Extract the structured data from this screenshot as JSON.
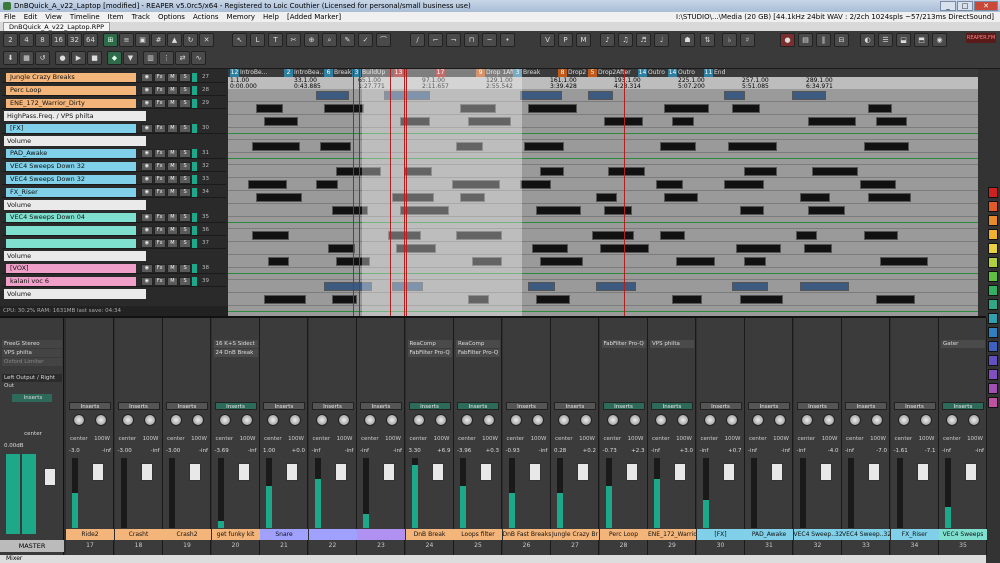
{
  "window": {
    "title": "DnBQuick_A_v22_Laptop [modified] - REAPER v5.0rc5/x64 - Registered to Loic Couthier (Licensed for personal/small business use)",
    "buttons": [
      "_",
      "□",
      "✕"
    ]
  },
  "menu": {
    "items": [
      "File",
      "Edit",
      "View",
      "Timeline",
      "Item",
      "Track",
      "Options",
      "Actions",
      "Memory",
      "Help",
      "[Added Marker]"
    ],
    "status": "I:\\STUDIO\\...\\Media (20 GB) [44.1kHz 24bit WAV : 2/2ch 1024spls ~57/213ms DirectSound]"
  },
  "project_tab": "DnBQuick_A_v22_Laptop.RPP",
  "toolbar": {
    "grid_values": [
      "2",
      "4",
      "8",
      "16",
      "32",
      "64"
    ],
    "brand": "REAPER.FM"
  },
  "regions": [
    {
      "num": "12",
      "name": "IntroBe...",
      "color": "#2e7fa0"
    },
    {
      "num": "2",
      "name": "IntroBea...",
      "color": "#2e7fa0"
    },
    {
      "num": "6",
      "name": "Break2",
      "color": "#2e7fa0"
    },
    {
      "num": "3",
      "name": "BuildUp",
      "color": "#2e7fa0"
    },
    {
      "num": "13",
      "name": "",
      "color": "#a02020"
    },
    {
      "num": "17",
      "name": "",
      "color": "#a02020"
    },
    {
      "num": "9",
      "name": "Drop 1Afte",
      "color": "#c05a1a"
    },
    {
      "num": "3",
      "name": "Break",
      "color": "#2e7fa0"
    },
    {
      "num": "8",
      "name": "Drop2",
      "color": "#c05a1a"
    },
    {
      "num": "5",
      "name": "Drop2After",
      "color": "#c05a1a"
    },
    {
      "num": "14",
      "name": "Outro",
      "color": "#2e7fa0"
    },
    {
      "num": "14",
      "name": "Outro",
      "color": "#2e7fa0"
    },
    {
      "num": "11",
      "name": "End",
      "color": "#2e7fa0"
    }
  ],
  "ruler": [
    {
      "bar": "1.1.00",
      "time": "0:00.000"
    },
    {
      "bar": "33.1.00",
      "time": "0:43.885"
    },
    {
      "bar": "65.1.00",
      "time": "1:27.771"
    },
    {
      "bar": "97.1.00",
      "time": "2:11.657"
    },
    {
      "bar": "129.1.00",
      "time": "2:55.542"
    },
    {
      "bar": "161.1.00",
      "time": "3:39.428"
    },
    {
      "bar": "193.1.00",
      "time": "4:23.314"
    },
    {
      "bar": "225.1.00",
      "time": "5:07.200"
    },
    {
      "bar": "257.1.00",
      "time": "5:51.085"
    },
    {
      "bar": "289.1.00",
      "time": "6:34.971"
    }
  ],
  "tracks": [
    {
      "name": "Jungle Crazy Breaks",
      "color": "#f4b57a",
      "num": "27",
      "type": "track"
    },
    {
      "name": "Perc Loop",
      "color": "#f4b57a",
      "num": "28",
      "type": "track"
    },
    {
      "name": "ENE_172_Warrior_Dirty",
      "color": "#f4b57a",
      "num": "29",
      "type": "track"
    },
    {
      "name": "HighPass.Freq. / VPS philta",
      "color": "#eaeaea",
      "num": "",
      "type": "env"
    },
    {
      "name": "[FX]",
      "color": "#7fd0e8",
      "num": "30",
      "type": "track"
    },
    {
      "name": "Volume",
      "color": "#eaeaea",
      "num": "",
      "type": "env"
    },
    {
      "name": "PAD_Awake",
      "color": "#7fd0e8",
      "num": "31",
      "type": "track"
    },
    {
      "name": "VEC4 Sweeps Down 32",
      "color": "#7fd0e8",
      "num": "32",
      "type": "track"
    },
    {
      "name": "VEC4 Sweeps Down 32",
      "color": "#7fd0e8",
      "num": "33",
      "type": "track"
    },
    {
      "name": "FX_Riser",
      "color": "#7fd0e8",
      "num": "34",
      "type": "track"
    },
    {
      "name": "Volume",
      "color": "#eaeaea",
      "num": "",
      "type": "env"
    },
    {
      "name": "VEC4 Sweeps Down 04",
      "color": "#7fe0d0",
      "num": "35",
      "type": "track"
    },
    {
      "name": "",
      "color": "#7fe0d0",
      "num": "36",
      "type": "track"
    },
    {
      "name": "",
      "color": "#7fe0d0",
      "num": "37",
      "type": "track"
    },
    {
      "name": "Volume",
      "color": "#eaeaea",
      "num": "",
      "type": "env"
    },
    {
      "name": "[VOX]",
      "color": "#f0a0c8",
      "num": "38",
      "type": "track"
    },
    {
      "name": "kalani voc 6",
      "color": "#f0a0c8",
      "num": "39",
      "type": "track"
    },
    {
      "name": "Volume",
      "color": "#eaeaea",
      "num": "",
      "type": "env"
    }
  ],
  "track_buttons": [
    "◉",
    "Fx",
    "M",
    "S"
  ],
  "cpu_status": "CPU: 30.2%  RAM: 1631MB  last save: 04:34",
  "mixer": {
    "master": {
      "name": "MASTER",
      "fx": [
        "FreeG Stereo",
        "VPS philta",
        "Oxford Limiter"
      ],
      "routing": "Left Output / Right Out",
      "inserts": "Inserts",
      "pan": "center",
      "db": "0.00dB",
      "levels": [
        "-0.2",
        "-0.2"
      ]
    },
    "strips": [
      {
        "name": "Ride2",
        "idx": "17",
        "vol": "-3.0",
        "color": "#f4b57a",
        "fx": [],
        "db": [
          "-inf",
          "-inf"
        ],
        "level": 0.5
      },
      {
        "name": "Crasht",
        "idx": "18",
        "vol": "-3.00",
        "color": "#f4b57a",
        "fx": [],
        "db": [
          "-inf",
          "-inf"
        ],
        "level": 0
      },
      {
        "name": "Crash2",
        "idx": "19",
        "vol": "-3.00",
        "color": "#f4b57a",
        "fx": [],
        "db": [
          "-inf",
          "-inf"
        ],
        "level": 0
      },
      {
        "name": "get funky kit",
        "idx": "20",
        "vol": "-3.69",
        "color": "#f4b57a",
        "fx": [
          "16 K+S Sidect",
          "24 DnB Break"
        ],
        "db": [
          "-inf",
          "-inf"
        ],
        "level": 0.1
      },
      {
        "name": "Snare",
        "idx": "21",
        "vol": "1.00",
        "color": "#a0a0ff",
        "fx": [],
        "db": [
          "+0.0",
          "-inf"
        ],
        "level": 0.6
      },
      {
        "name": "",
        "idx": "22",
        "vol": "-inf",
        "color": "#a0a0ff",
        "fx": [],
        "db": [
          "-inf",
          "+0.0"
        ],
        "level": 0.7
      },
      {
        "name": "",
        "idx": "23",
        "vol": "-inf",
        "color": "#b090f0",
        "fx": [],
        "db": [
          "-inf",
          "-inf"
        ],
        "level": 0.2
      },
      {
        "name": "DnB Break",
        "idx": "24",
        "vol": "3.30",
        "color": "#f4b57a",
        "fx": [
          "ReaComp",
          "FabFilter Pro-Q"
        ],
        "db": [
          "+6.9",
          "-inf"
        ],
        "level": 0.9
      },
      {
        "name": "Loops filter",
        "idx": "25",
        "vol": "-3.96",
        "color": "#f4b57a",
        "fx": [
          "ReaComp",
          "FabFilter Pro-Q"
        ],
        "db": [
          "+0.3",
          "-inf"
        ],
        "level": 0.6
      },
      {
        "name": "DnB Fast Breaks",
        "idx": "26",
        "vol": "-0.93",
        "color": "#f4b57a",
        "fx": [],
        "db": [
          "-inf",
          "-inf"
        ],
        "level": 0.5
      },
      {
        "name": "Jungle Crazy Br",
        "idx": "27",
        "vol": "0.28",
        "color": "#f4b57a",
        "fx": [],
        "db": [
          "+0.2",
          "-inf"
        ],
        "level": 0.5
      },
      {
        "name": "Perc Loop",
        "idx": "28",
        "vol": "-0.73",
        "color": "#f4b57a",
        "fx": [
          "FabFilter Pro-Q"
        ],
        "db": [
          "+2.3",
          "-inf"
        ],
        "level": 0.6
      },
      {
        "name": "ENE_172_Warrio",
        "idx": "29",
        "vol": "-inf",
        "color": "#f4b57a",
        "fx": [
          "VPS philta"
        ],
        "db": [
          "+3.0",
          "-inf"
        ],
        "level": 0.7
      },
      {
        "name": "[FX]",
        "idx": "30",
        "vol": "-inf",
        "color": "#7fd0e8",
        "fx": [],
        "db": [
          "+0.7",
          "-inf"
        ],
        "level": 0.4
      },
      {
        "name": "PAD_Awake",
        "idx": "31",
        "vol": "-inf",
        "color": "#7fd0e8",
        "fx": [],
        "db": [
          "-inf",
          "-inf"
        ],
        "level": 0
      },
      {
        "name": "VEC4 Sweep..32",
        "idx": "32",
        "vol": "-inf",
        "color": "#7fd0e8",
        "fx": [],
        "db": [
          "-4.0",
          "-inf"
        ],
        "level": 0
      },
      {
        "name": "VEC4 Sweep..32",
        "idx": "33",
        "vol": "-inf",
        "color": "#7fd0e8",
        "fx": [],
        "db": [
          "-7.0",
          "-inf"
        ],
        "level": 0
      },
      {
        "name": "FX_Riser",
        "idx": "34",
        "vol": "-1.61",
        "color": "#7fd0e8",
        "fx": [],
        "db": [
          "-7.1",
          "-inf"
        ],
        "level": 0
      },
      {
        "name": "VEC4 Sweeps",
        "idx": "35",
        "vol": "-inf",
        "color": "#7fe0d0",
        "fx": [
          "Gater"
        ],
        "db": [
          "-inf",
          "-inf"
        ],
        "level": 0.3
      }
    ],
    "inserts_label": "Inserts",
    "pan_label": "center",
    "width_label": "100W"
  },
  "mixer_tab": "Mixer",
  "colors": {
    "accent_teal": "#1ea88a",
    "selection": "#ffffff",
    "marker": "#b02020"
  }
}
